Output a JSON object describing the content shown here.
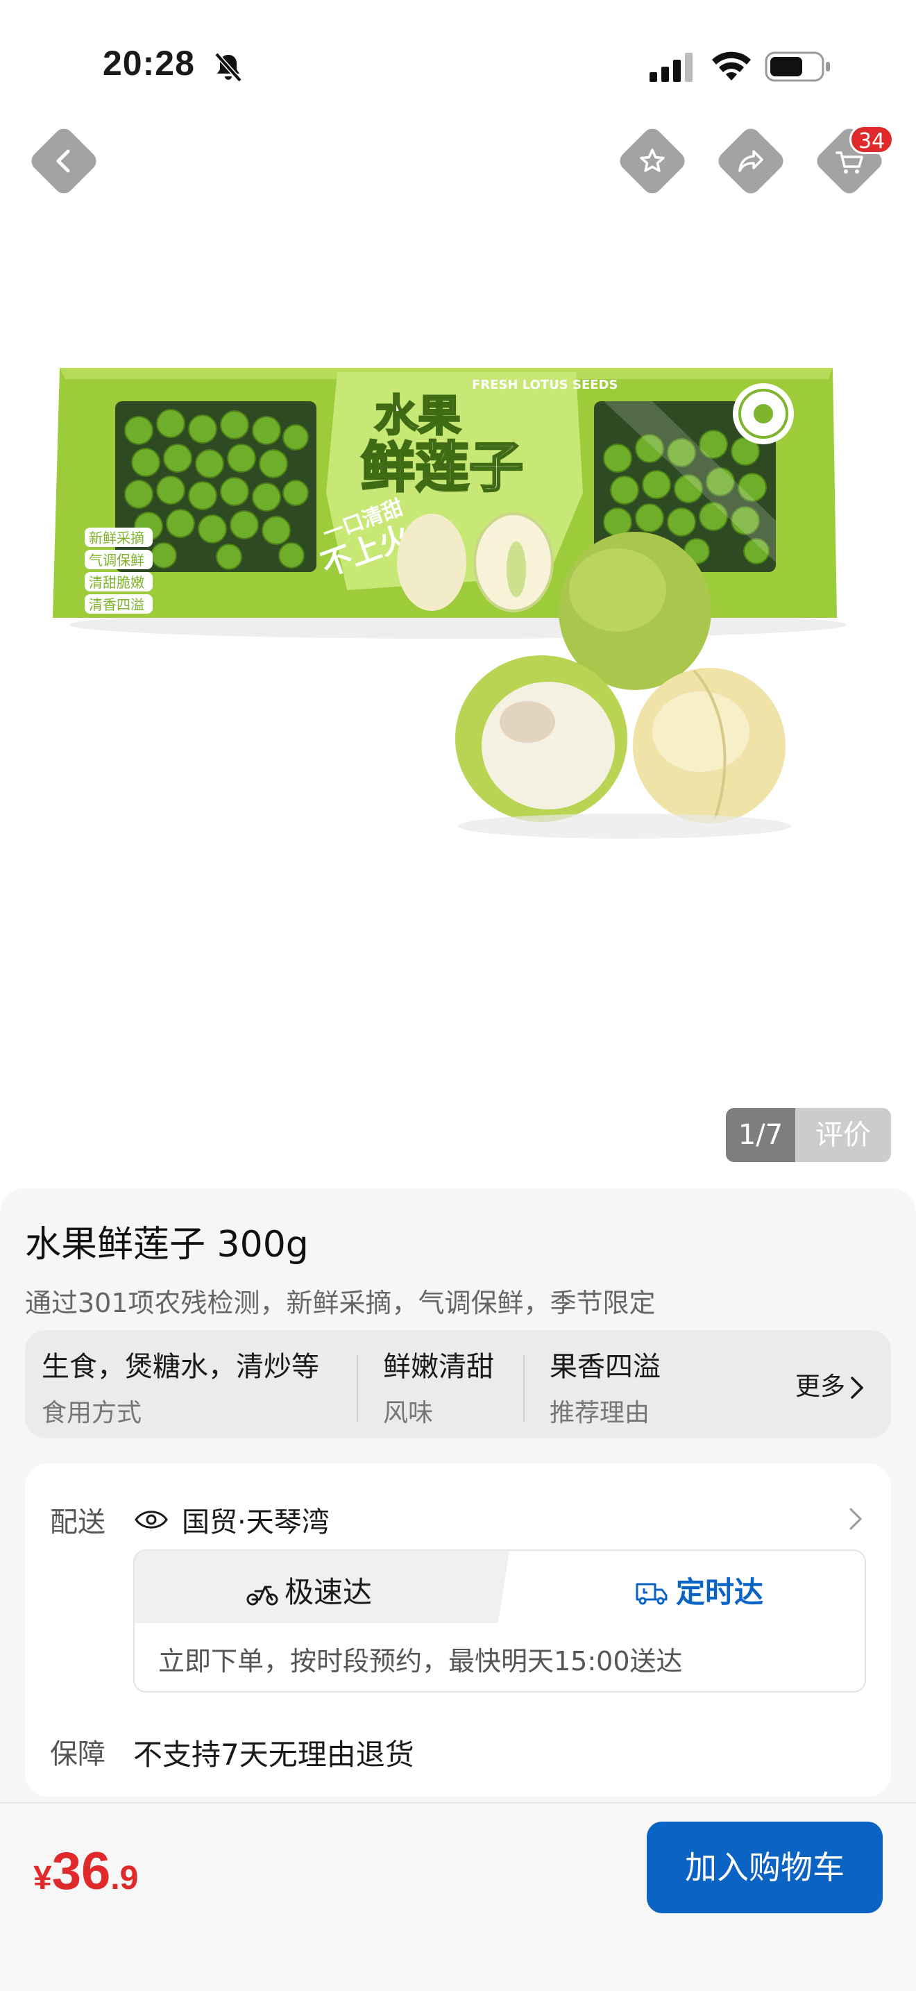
{
  "status_bar": {
    "time": "20:28",
    "icons": [
      "bell-off-icon",
      "signal-icon",
      "wifi-icon",
      "battery-icon"
    ]
  },
  "nav": {
    "icons": [
      "back-icon",
      "star-icon",
      "share-icon",
      "cart-icon"
    ],
    "cart_count": "34"
  },
  "hero": {
    "counter": "1/7",
    "reviews_label": "评价",
    "package_text": {
      "main": "水果",
      "main2": "鲜莲子",
      "en": "FRESH LOTUS SEEDS",
      "slogan1": "一口清甜",
      "slogan2": "不上火",
      "tags": [
        "新鲜采摘",
        "气调保鲜",
        "清甜脆嫩",
        "清香四溢"
      ]
    }
  },
  "product": {
    "title": "水果鲜莲子 300g",
    "subtitle": "通过301项农残检测，新鲜采摘，气调保鲜，季节限定",
    "attributes": [
      {
        "value": "生食，煲糖水，清炒等",
        "key": "食用方式"
      },
      {
        "value": "鲜嫩清甜",
        "key": "风味"
      },
      {
        "value": "果香四溢",
        "key": "推荐理由"
      }
    ],
    "more_label": "更多"
  },
  "delivery": {
    "label": "配送",
    "location": "国贸·天琴湾",
    "tabs": [
      {
        "label": "极速达",
        "icon": "scooter-icon",
        "active": false
      },
      {
        "label": "定时达",
        "icon": "truck-clock-icon",
        "active": true
      }
    ],
    "description": "立即下单，按时段预约，最快明天15:00送达",
    "guarantee_label": "保障",
    "guarantee_text": "不支持7天无理由退货"
  },
  "bottom": {
    "price_symbol": "¥",
    "price_int": "36",
    "price_dec": ".9",
    "add_to_cart": "加入购物车"
  },
  "colors": {
    "accent": "#0b63c4",
    "price": "#e0292b",
    "badge": "#e0292b",
    "package_green": "#9ccc3a"
  }
}
